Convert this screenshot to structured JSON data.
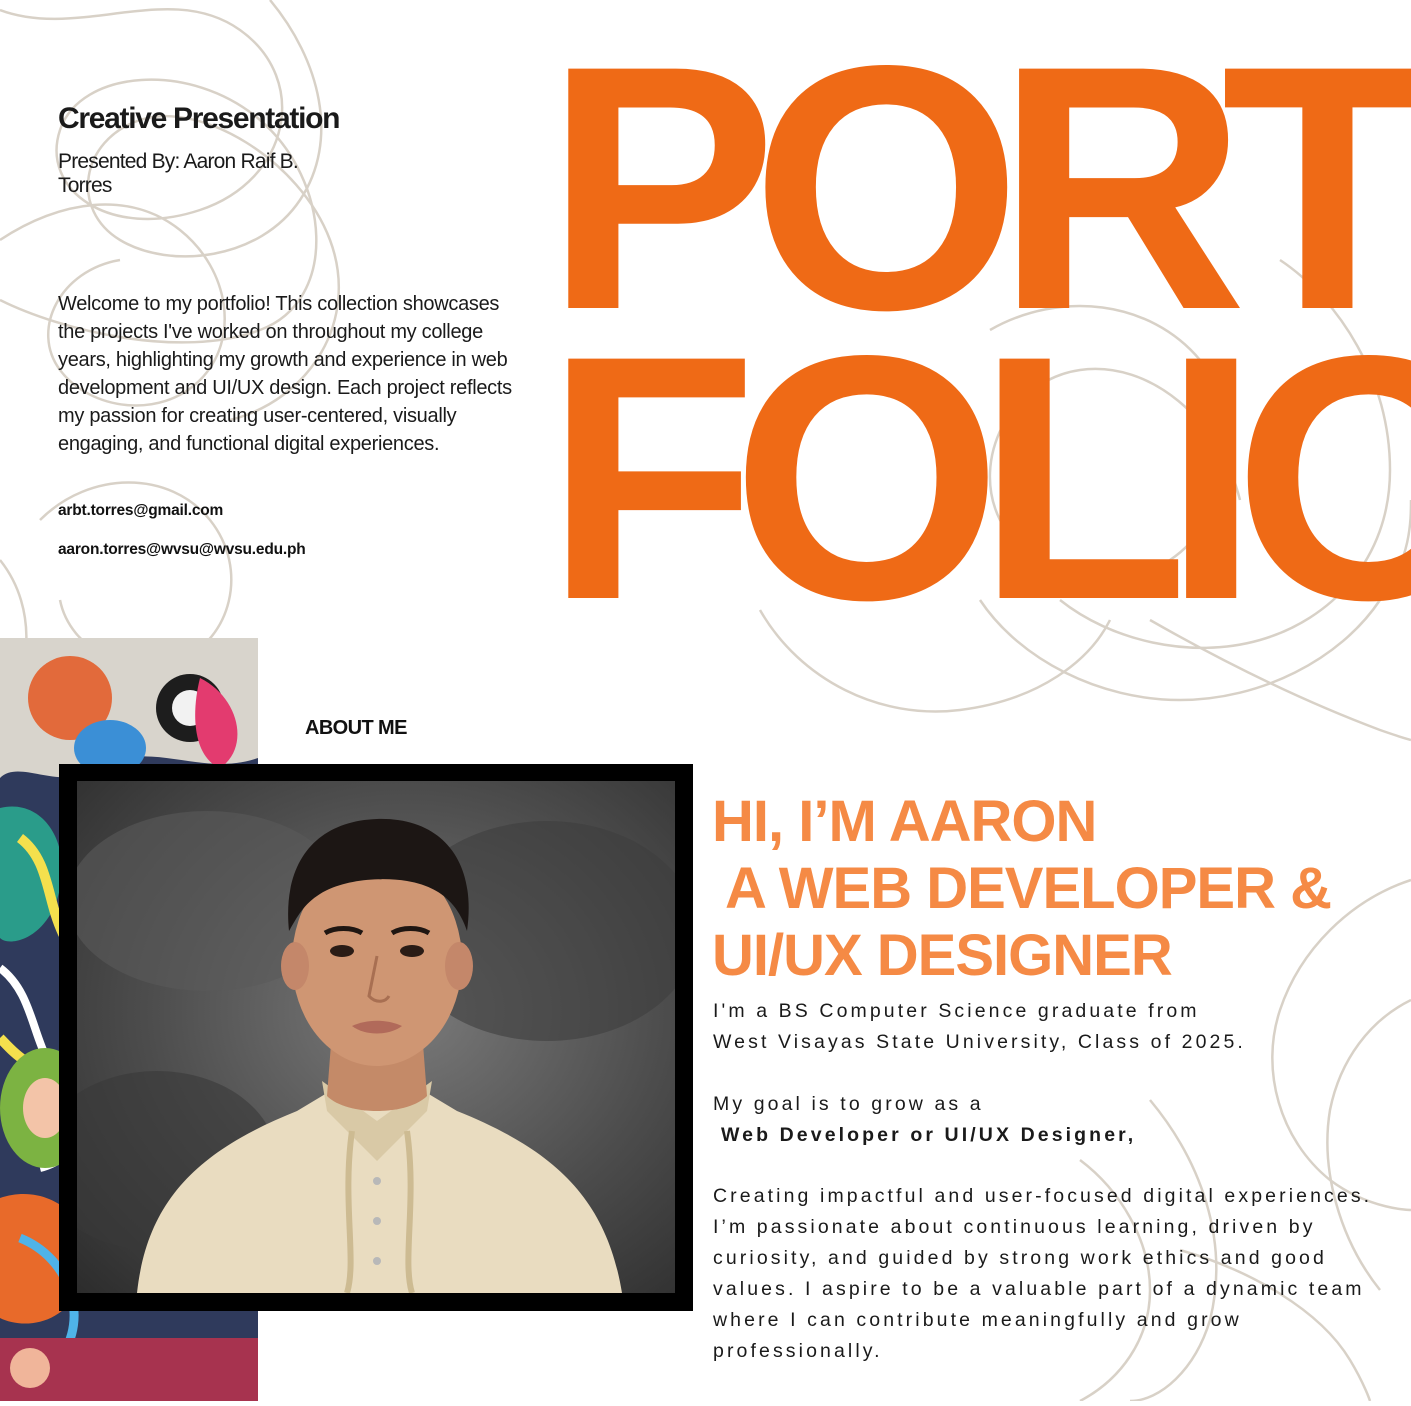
{
  "header": {
    "title": "Creative Presentation",
    "presented_by": "Presented By: Aaron Raif B. Torres"
  },
  "intro": {
    "text": "Welcome to my portfolio! This collection showcases the projects I've worked on throughout my college years, highlighting my growth and experience in web development and UI/UX design. Each project reflects my passion for creating user-centered, visually engaging, and functional digital experiences."
  },
  "contacts": {
    "email_primary": "arbt.torres@gmail.com",
    "email_school": "aaron.torres@wvsu@wvsu.edu.ph"
  },
  "hero": {
    "line1": "PORT",
    "line2": "FOLIO"
  },
  "about": {
    "label": "ABOUT ME",
    "headline_line1": "HI, I’M AARON",
    "headline_line2": " A WEB DEVELOPER &",
    "headline_line3": "UI/UX DESIGNER",
    "education_line1": "I'm a BS Computer Science graduate from",
    "education_line2": "West Visayas State University, Class of 2025.",
    "goal_line1": "My goal is to grow as a",
    "goal_role": "Web Developer or UI/UX Designer,",
    "paragraph": "Creating impactful and user-focused digital experiences. I’m passionate about continuous learning, driven by curiosity, and guided by strong work ethics and good values. I aspire to be a valuable part of a dynamic team where I can contribute meaningfully and grow professionally."
  },
  "colors": {
    "accent_orange": "#ef6a16",
    "headline_orange": "#f58a45",
    "decor_line": "#d8d1c7",
    "photo_frame": "#000000"
  }
}
